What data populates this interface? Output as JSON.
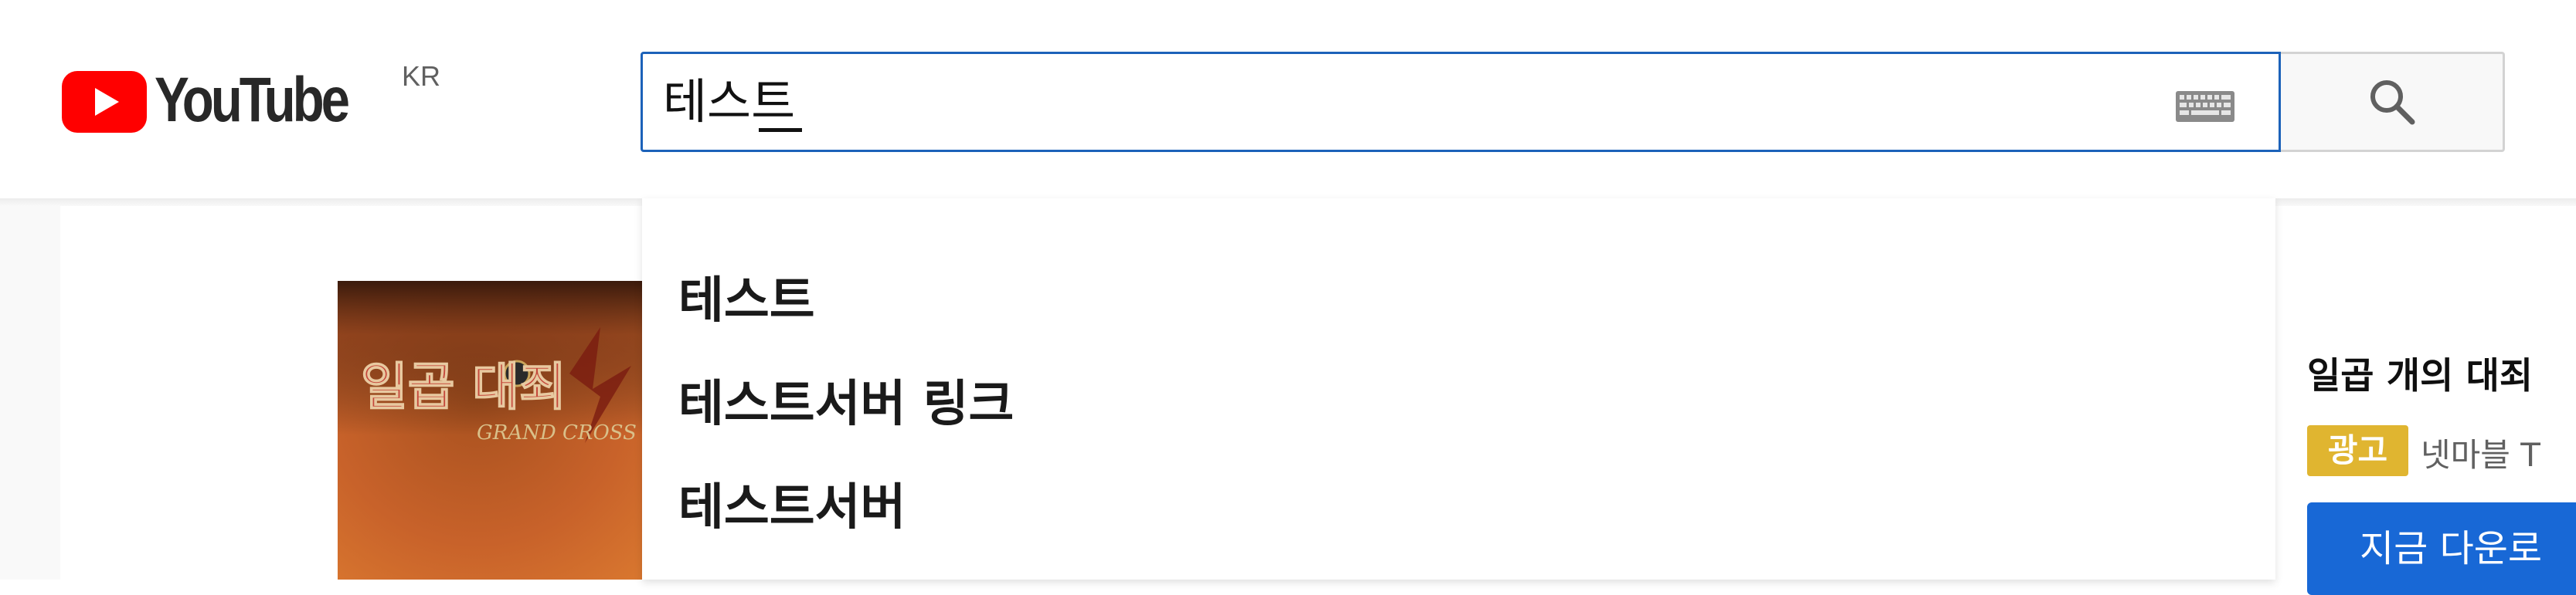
{
  "header": {
    "logo_text": "YouTube",
    "country_code": "KR",
    "logo_color": "#ff0000"
  },
  "search": {
    "value": "테스트",
    "keyboard_icon": "keyboard-icon",
    "button_icon": "search-icon",
    "focus_color": "#1c62b9"
  },
  "suggestions": [
    {
      "label": "테스트"
    },
    {
      "label": "테스트서버 링크"
    },
    {
      "label": "테스트서버"
    }
  ],
  "ad": {
    "thumb_title": "일곱 대죄",
    "thumb_subtitle": "GRAND CROSS",
    "title": "일곱 개의 대죄",
    "badge": "광고",
    "advertiser": "넷마블 T",
    "cta": "지금 다운로",
    "badge_color": "#e0b530",
    "cta_color": "#1868d6"
  }
}
